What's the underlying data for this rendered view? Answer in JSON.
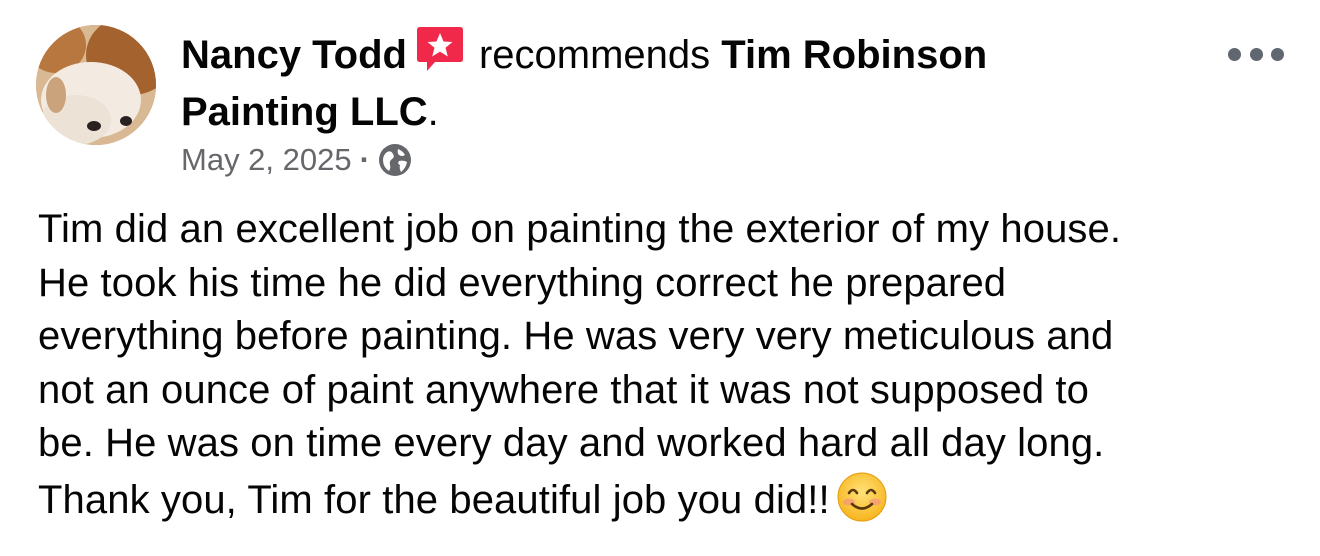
{
  "post": {
    "author": "Nancy Todd",
    "recommends_text": "recommends",
    "page_name_line1": "Tim Robinson",
    "page_name_line2": "Painting LLC",
    "page_suffix": ".",
    "date": "May 2, 2025",
    "separator": "·",
    "privacy_icon": "globe-icon",
    "recommendation_badge_icon": "recommendation-star-icon",
    "badge_color": "#f0284a",
    "more_icon": "more-options-icon",
    "body_lines": [
      "Tim did an excellent job on painting the exterior of my house.",
      "He took his time he did everything correct he prepared",
      "everything before painting. He was very very meticulous and",
      "not an ounce of paint anywhere that it was not supposed to",
      "be. He was on time every day and worked hard all day long.",
      "Thank you, Tim for the beautiful job you did!!"
    ],
    "trailing_emoji": "smiling-face-emoji"
  },
  "colors": {
    "text_primary": "#050505",
    "text_secondary": "#65676b",
    "icon_gray": "#606770"
  }
}
